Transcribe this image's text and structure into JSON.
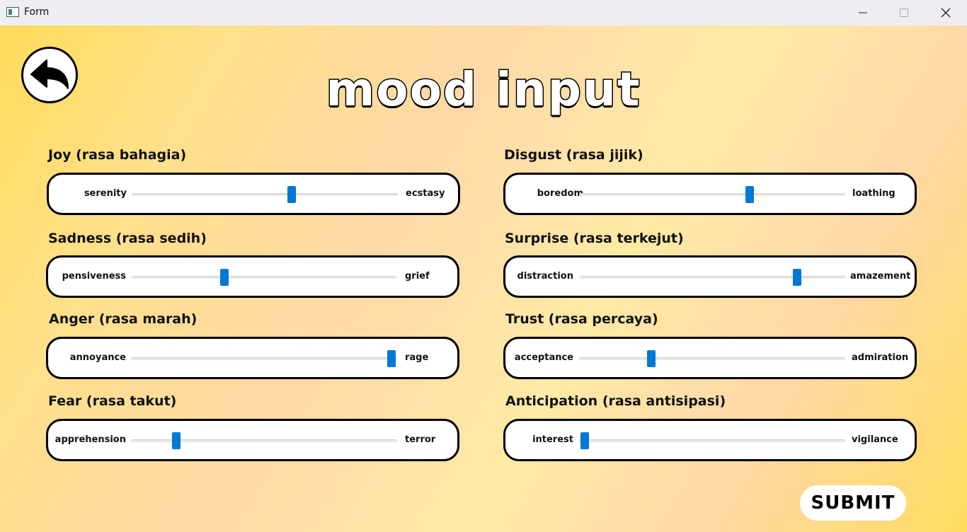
{
  "window": {
    "title": "Form",
    "icons": {
      "minimize": "minimize-icon",
      "maximize": "maximize-icon",
      "close": "close-icon"
    }
  },
  "header": {
    "title": "mood input",
    "back_icon": "back-arrow-icon"
  },
  "emotions": [
    {
      "label": "Joy (rasa bahagia)",
      "low": "serenity",
      "high": "ecstasy",
      "value": 60
    },
    {
      "label": "Sadness (rasa sedih)",
      "low": "pensiveness",
      "high": "grief",
      "value": 35
    },
    {
      "label": "Anger (rasa marah)",
      "low": "annoyance",
      "high": "rage",
      "value": 98
    },
    {
      "label": "Fear (rasa takut)",
      "low": "apprehension",
      "high": "terror",
      "value": 17
    },
    {
      "label": "Disgust (rasa jijik)",
      "low": "boredom",
      "high": "loathing",
      "value": 64
    },
    {
      "label": "Surprise (rasa terkejut)",
      "low": "distraction",
      "high": "amazement",
      "value": 82
    },
    {
      "label": "Trust (rasa percaya)",
      "low": "acceptance",
      "high": "admiration",
      "value": 27
    },
    {
      "label": "Anticipation (rasa antisipasi)",
      "low": "interest",
      "high": "vigilance",
      "value": 2
    }
  ],
  "submit": {
    "label": "SUBMIT"
  },
  "colors": {
    "slider_thumb": "#0078d7",
    "background_gradient_start": "#ffdb5a",
    "background_mid": "#ffe8b0"
  }
}
